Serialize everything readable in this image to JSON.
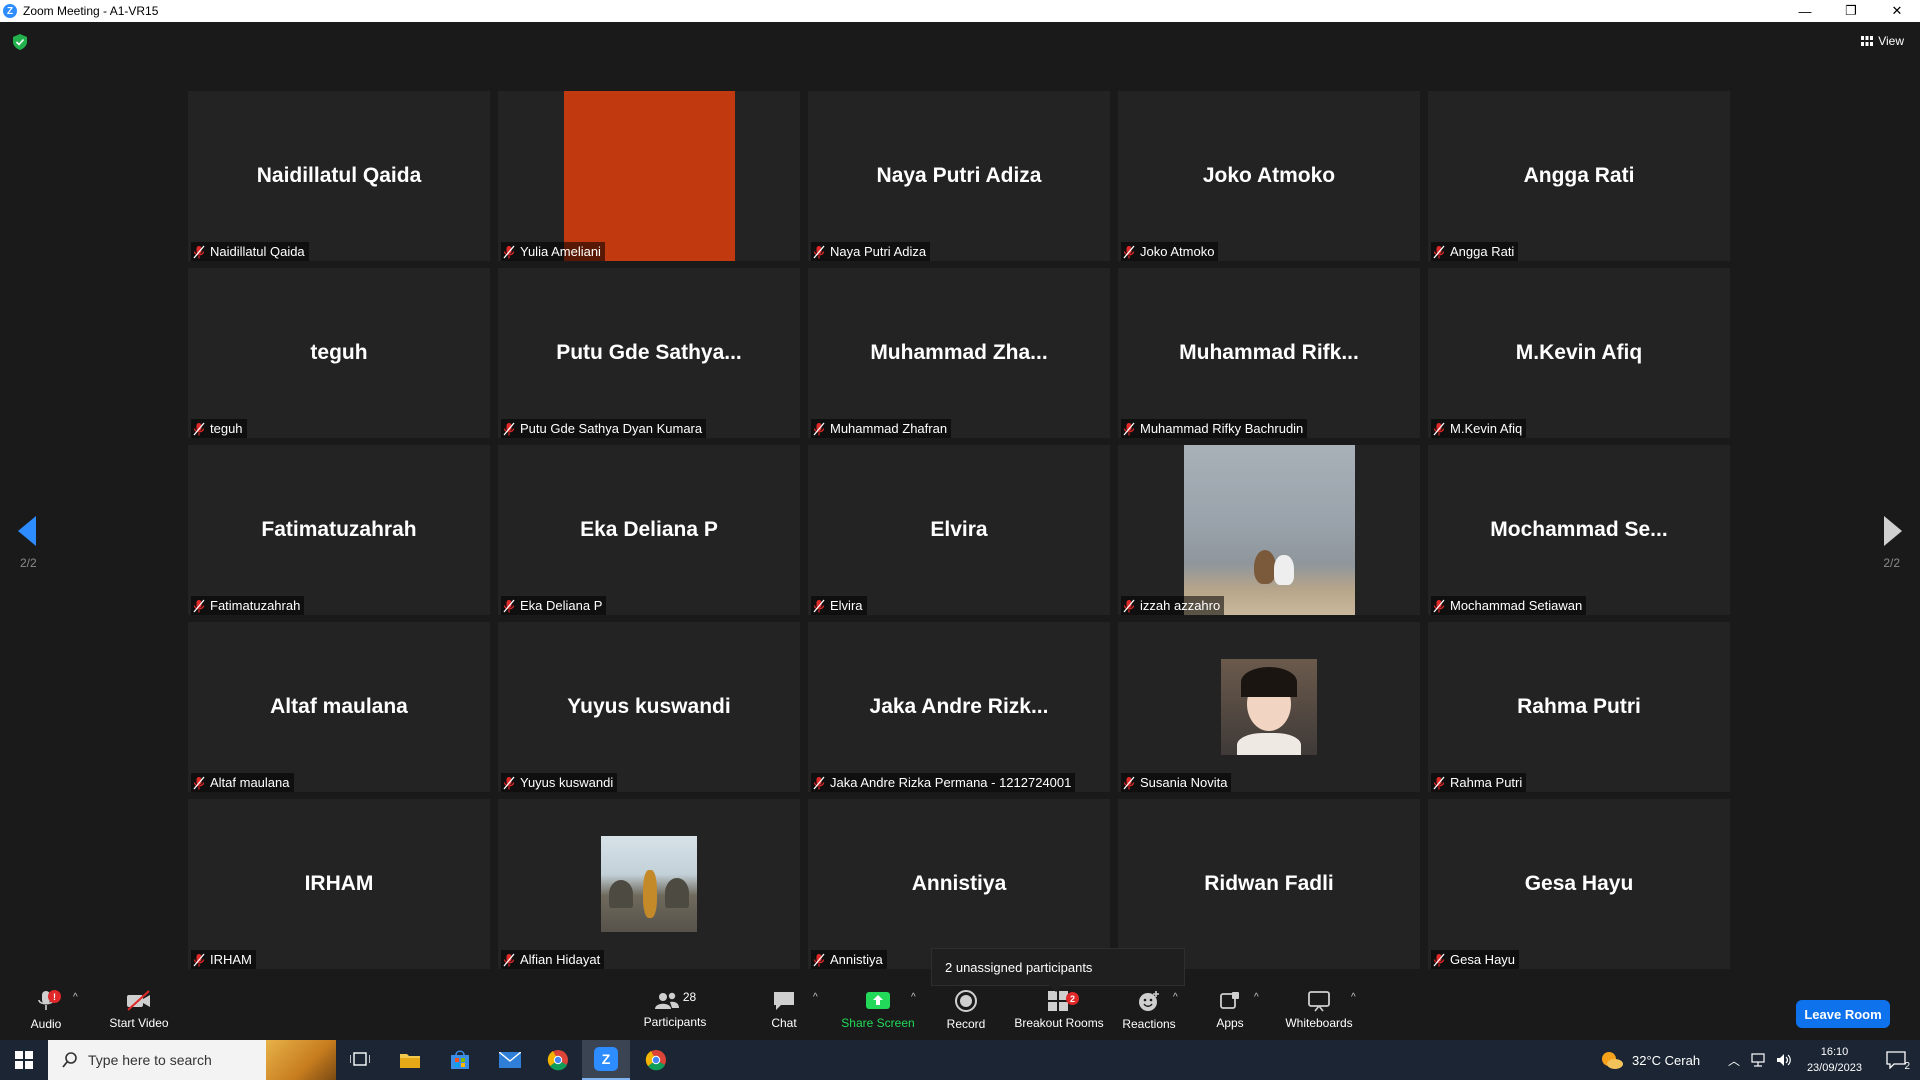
{
  "window": {
    "title": "Zoom Meeting - A1-VR15",
    "minimize": "—",
    "restore": "❐",
    "close": "✕"
  },
  "header": {
    "view_label": "View"
  },
  "pagination": {
    "left_page": "2/2",
    "right_page": "2/2"
  },
  "tiles": [
    {
      "display": "Naidillatul Qaida",
      "label": "Naidillatul Qaida",
      "media": "none"
    },
    {
      "display": "",
      "label": "Yulia Ameliani",
      "media": "orange-block"
    },
    {
      "display": "Naya Putri Adiza",
      "label": "Naya Putri Adiza",
      "media": "none"
    },
    {
      "display": "Joko Atmoko",
      "label": "Joko Atmoko",
      "media": "none"
    },
    {
      "display": "Angga Rati",
      "label": "Angga Rati",
      "media": "none"
    },
    {
      "display": "teguh",
      "label": "teguh",
      "media": "none"
    },
    {
      "display": "Putu Gde Sathya...",
      "label": "Putu Gde Sathya Dyan Kumara",
      "media": "none"
    },
    {
      "display": "Muhammad  Zha...",
      "label": "Muhammad Zhafran",
      "media": "none"
    },
    {
      "display": "Muhammad  Rifk...",
      "label": "Muhammad Rifky Bachrudin",
      "media": "none"
    },
    {
      "display": "M.Kevin Afiq",
      "label": "M.Kevin Afiq",
      "media": "none"
    },
    {
      "display": "Fatimatuzahrah",
      "label": "Fatimatuzahrah",
      "media": "none"
    },
    {
      "display": "Eka Deliana P",
      "label": "Eka Deliana P",
      "media": "none"
    },
    {
      "display": "Elvira",
      "label": "Elvira",
      "media": "none"
    },
    {
      "display": "",
      "label": "izzah azzahro",
      "media": "photo-cats"
    },
    {
      "display": "Mochammad  Se...",
      "label": "Mochammad Setiawan",
      "media": "none"
    },
    {
      "display": "Altaf maulana",
      "label": "Altaf maulana",
      "media": "none"
    },
    {
      "display": "Yuyus kuswandi",
      "label": "Yuyus kuswandi",
      "media": "none"
    },
    {
      "display": "Jaka Andre Rizk...",
      "label": "Jaka Andre Rizka Permana - 1212724001",
      "media": "none"
    },
    {
      "display": "",
      "label": "Susania Novita",
      "media": "photo-portrait"
    },
    {
      "display": "Rahma Putri",
      "label": "Rahma Putri",
      "media": "none"
    },
    {
      "display": "IRHAM",
      "label": "IRHAM",
      "media": "none"
    },
    {
      "display": "",
      "label": "Alfian Hidayat",
      "media": "photo-temple"
    },
    {
      "display": "Annistiya",
      "label": "Annistiya",
      "media": "none"
    },
    {
      "display": "Ridwan Fadli",
      "label": "Fadli",
      "media": "none"
    },
    {
      "display": "Gesa Hayu",
      "label": "Gesa Hayu",
      "media": "none"
    }
  ],
  "popup": {
    "text": "2 unassigned participants"
  },
  "toolbar": {
    "audio_label": "Audio",
    "audio_badge": "!",
    "video_label": "Start Video",
    "participants_label": "Participants",
    "participants_count": "28",
    "chat_label": "Chat",
    "share_label": "Share Screen",
    "record_label": "Record",
    "breakout_label": "Breakout Rooms",
    "breakout_badge": "2",
    "reactions_label": "Reactions",
    "apps_label": "Apps",
    "whiteboards_label": "Whiteboards",
    "leave_label": "Leave Room",
    "caret": "^"
  },
  "colors": {
    "accent_blue": "#0e72ed",
    "share_green": "#23d959",
    "mute_red": "#e02828",
    "tile_bg": "#232323",
    "orange_tile": "#c1390f"
  },
  "taskbar": {
    "search_placeholder": "Type here to search",
    "weather": "32°C  Cerah",
    "time": "16:10",
    "date": "23/09/2023",
    "notifications": "2"
  }
}
